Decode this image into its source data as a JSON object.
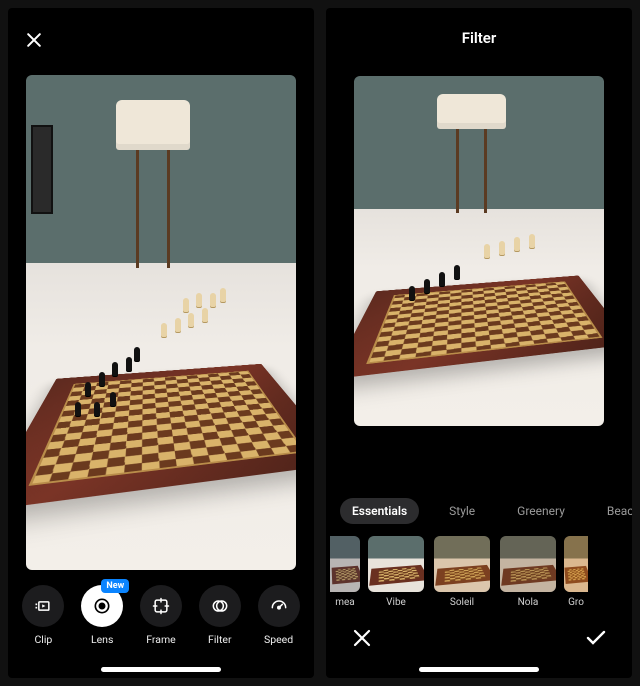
{
  "left": {
    "toolbar": {
      "items": [
        {
          "label": "Clip",
          "icon": "clip-icon"
        },
        {
          "label": "Lens",
          "icon": "lens-icon",
          "badge": "New",
          "active": true
        },
        {
          "label": "Frame",
          "icon": "frame-icon"
        },
        {
          "label": "Filter",
          "icon": "filter-icon"
        },
        {
          "label": "Speed",
          "icon": "speed-icon"
        }
      ]
    }
  },
  "right": {
    "title": "Filter",
    "categories": [
      {
        "label": "Essentials",
        "active": true
      },
      {
        "label": "Style"
      },
      {
        "label": "Greenery"
      },
      {
        "label": "Beach"
      }
    ],
    "filters": [
      {
        "label": "mea",
        "partial": "l",
        "variant": "cool"
      },
      {
        "label": "Vibe",
        "variant": "none"
      },
      {
        "label": "Soleil",
        "variant": "warm"
      },
      {
        "label": "Nola",
        "variant": "sep"
      },
      {
        "label": "Gro",
        "partial": "r",
        "variant": "orange"
      }
    ]
  }
}
